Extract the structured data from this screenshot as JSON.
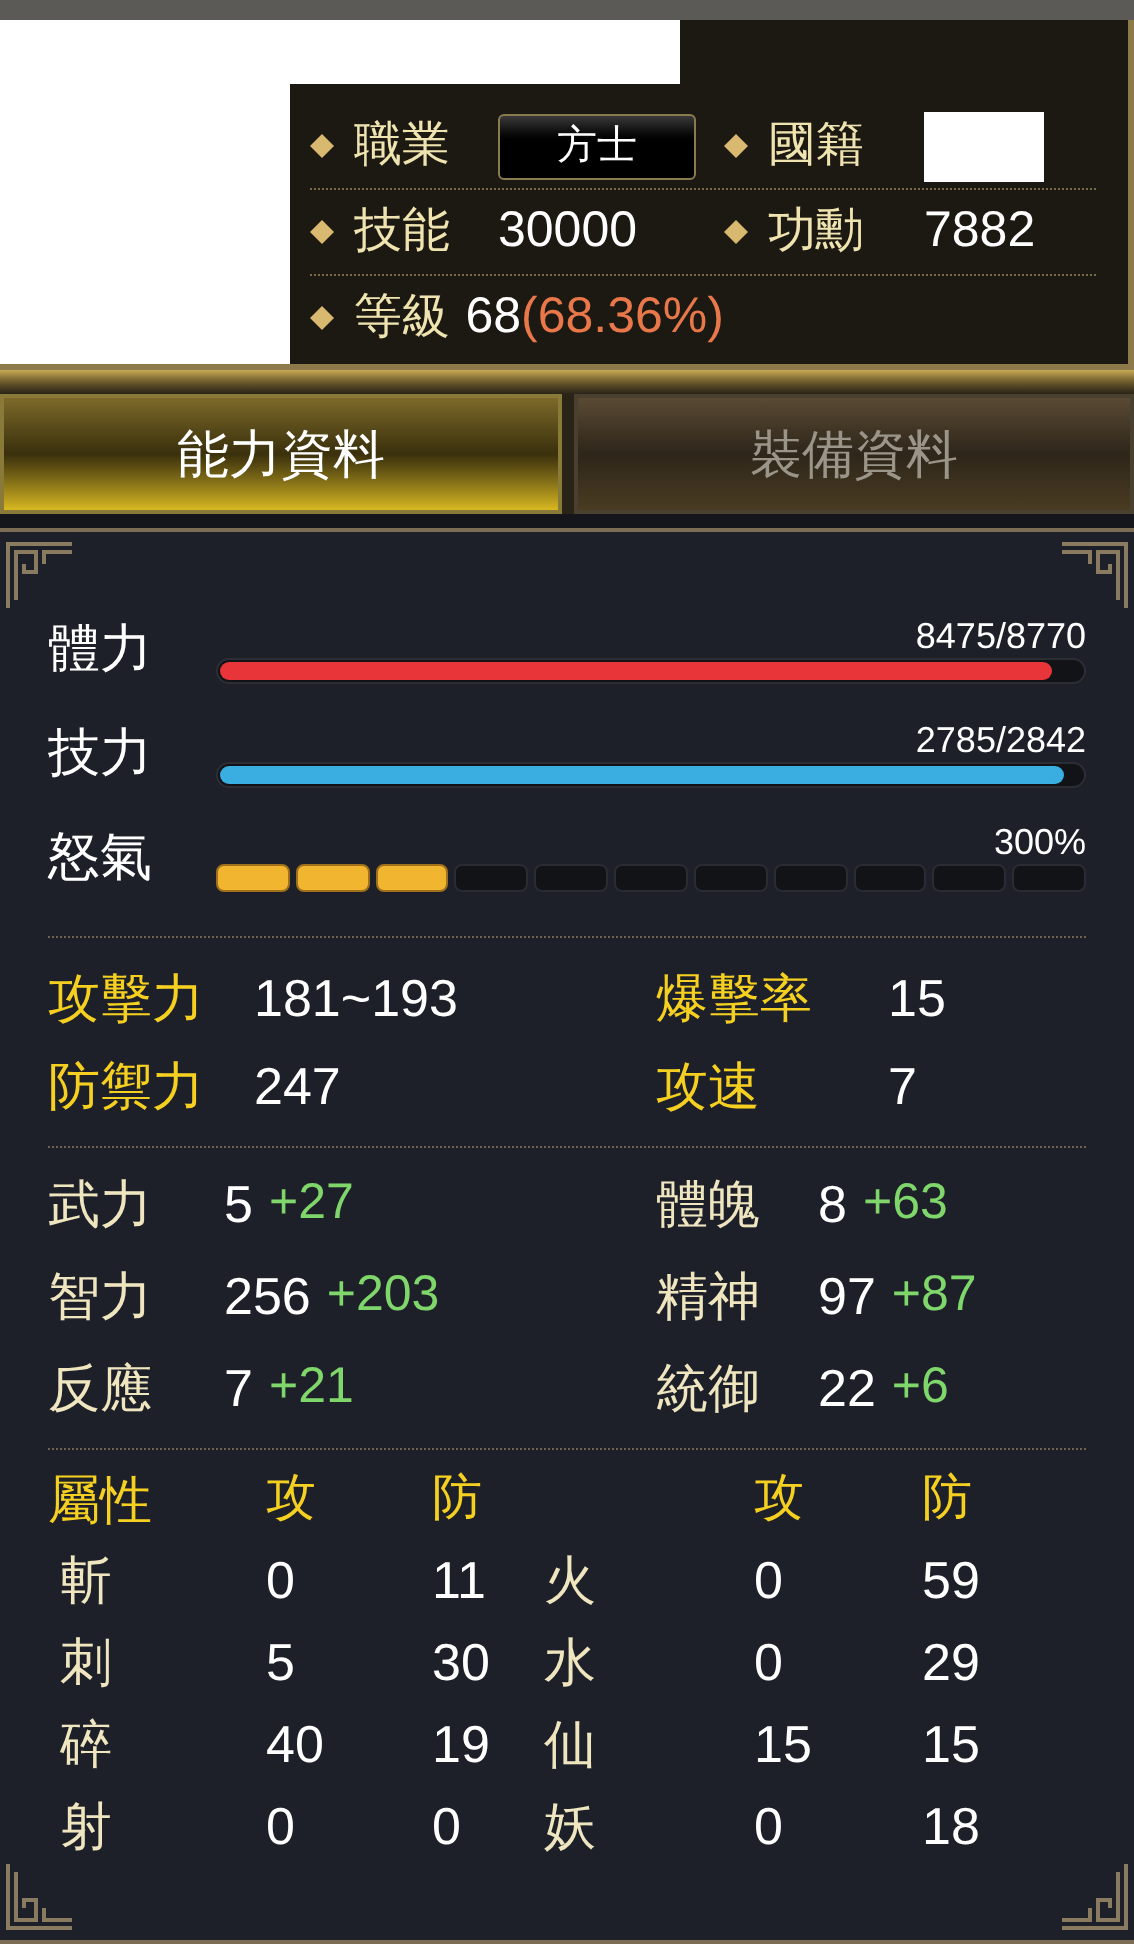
{
  "info": [
    {
      "label": "職業",
      "value": "方士",
      "kind": "badge"
    },
    {
      "label": "國籍",
      "kind": "redacted"
    },
    {
      "label": "技能",
      "value": "30000",
      "kind": "text"
    },
    {
      "label": "功勳",
      "value": "7882",
      "kind": "text"
    },
    {
      "label": "等級",
      "value": "68",
      "progress": "(68.36%)",
      "kind": "text"
    }
  ],
  "tabs": [
    {
      "label": "能力資料",
      "selected": true
    },
    {
      "label": "裝備資料",
      "selected": false
    }
  ],
  "gauges": [
    {
      "label": "體力",
      "reading": "8475/8770",
      "level": 0.966,
      "color": "#e8353a",
      "kind": "bar"
    },
    {
      "label": "技力",
      "reading": "2785/2842",
      "level": 0.98,
      "color": "#3aaee0",
      "kind": "bar"
    },
    {
      "label": "怒氣",
      "reading": "300%",
      "level": 0.27,
      "color": "#f2b530",
      "kind": "segments"
    }
  ],
  "combat": [
    {
      "label": "攻擊力",
      "value": "181~193"
    },
    {
      "label": "爆擊率",
      "value": "15"
    },
    {
      "label": "防禦力",
      "value": "247"
    },
    {
      "label": "攻速",
      "value": "7"
    }
  ],
  "attributes": [
    {
      "label": "武力",
      "base": "5",
      "bonus": "+27"
    },
    {
      "label": "體魄",
      "base": "8",
      "bonus": "+63"
    },
    {
      "label": "智力",
      "base": "256",
      "bonus": "+203"
    },
    {
      "label": "精神",
      "base": "97",
      "bonus": "+87"
    },
    {
      "label": "反應",
      "base": "7",
      "bonus": "+21"
    },
    {
      "label": "統御",
      "base": "22",
      "bonus": "+6"
    }
  ],
  "elements": {
    "header": {
      "label": "屬性",
      "attack": "攻",
      "defense": "防",
      "attack_2": "攻",
      "defense_2": "防"
    },
    "rows": [
      {
        "physical": "斬",
        "physical_attack": "0",
        "physical_defense": "11",
        "element": "火",
        "element_attack": "0",
        "element_defense": "59"
      },
      {
        "physical": "刺",
        "physical_attack": "5",
        "physical_defense": "30",
        "element": "水",
        "element_attack": "0",
        "element_defense": "29"
      },
      {
        "physical": "碎",
        "physical_attack": "40",
        "physical_defense": "19",
        "element": "仙",
        "element_attack": "15",
        "element_defense": "15"
      },
      {
        "physical": "射",
        "physical_attack": "0",
        "physical_defense": "0",
        "element": "妖",
        "element_attack": "0",
        "element_defense": "18"
      }
    ]
  }
}
